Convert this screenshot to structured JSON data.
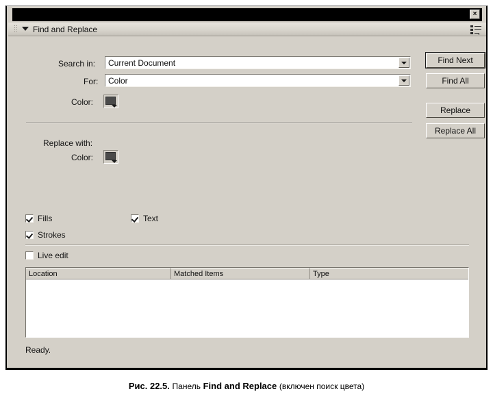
{
  "window": {
    "close_label": "×"
  },
  "panel": {
    "title": "Find and Replace",
    "collapse_icon": "triangle-down",
    "grip_icon": "drag-grip",
    "menu_icon": "panel-menu"
  },
  "form": {
    "search_in_label": "Search in:",
    "search_in_value": "Current Document",
    "for_label": "For:",
    "for_value": "Color",
    "color_label": "Color:",
    "color_value": "#4a4a4a",
    "replace_with_label": "Replace with:",
    "replace_color_label": "Color:",
    "replace_color_value": "#4a4a4a"
  },
  "buttons": {
    "find_next": "Find Next",
    "find_all": "Find All",
    "replace": "Replace",
    "replace_all": "Replace All"
  },
  "options": [
    {
      "label": "Fills",
      "checked": true
    },
    {
      "label": "Text",
      "checked": true
    },
    {
      "label": "Strokes",
      "checked": true
    },
    {
      "label": "Live edit",
      "checked": false
    }
  ],
  "results": {
    "columns": [
      "Location",
      "Matched Items",
      "Type"
    ],
    "rows": []
  },
  "status": {
    "text": "Ready."
  },
  "caption": {
    "figure_number": "Рис. 22.5.",
    "text_before": "Панель",
    "panel_name": "Find and Replace",
    "text_after": "(включен поиск цвета)"
  },
  "colors": {
    "face": "#d4d0c8",
    "titlebar": "#000000",
    "field": "#ffffff",
    "text": "#141414"
  }
}
